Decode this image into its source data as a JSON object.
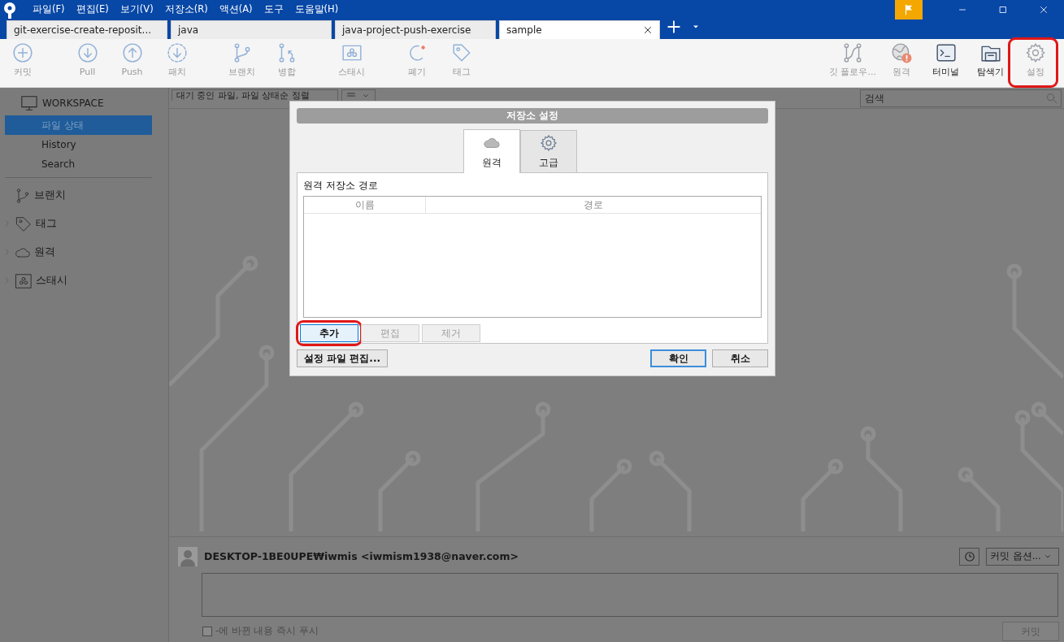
{
  "title_bar": {
    "menus": [
      "파일(F)",
      "편집(E)",
      "보기(V)",
      "저장소(R)",
      "액션(A)",
      "도구",
      "도움말(H)"
    ]
  },
  "tabs": [
    {
      "label": "git-exercise-create-reposit...",
      "selected": false
    },
    {
      "label": "java",
      "selected": false
    },
    {
      "label": "java-project-push-exercise",
      "selected": false
    },
    {
      "label": "sample",
      "selected": true
    }
  ],
  "toolbar": {
    "left_groups": [
      [
        {
          "label": "커밋",
          "kind": "commit",
          "disabled": true,
          "annotated": false
        }
      ],
      [
        {
          "label": "Pull",
          "kind": "pull",
          "disabled": true,
          "annotated": false
        },
        {
          "label": "Push",
          "kind": "push",
          "disabled": true,
          "annotated": false
        },
        {
          "label": "패치",
          "kind": "fetch",
          "disabled": true,
          "annotated": false
        }
      ],
      [
        {
          "label": "브랜치",
          "kind": "branch",
          "disabled": true,
          "annotated": false
        },
        {
          "label": "병합",
          "kind": "merge",
          "disabled": true,
          "annotated": false
        }
      ],
      [
        {
          "label": "스태시",
          "kind": "stash",
          "disabled": true,
          "annotated": false
        }
      ],
      [
        {
          "label": "폐기",
          "kind": "discard",
          "disabled": true,
          "annotated": false
        },
        {
          "label": "태그",
          "kind": "tag",
          "disabled": true,
          "annotated": false
        }
      ]
    ],
    "right": [
      {
        "label": "깃 플로우...",
        "kind": "gitflow",
        "disabled": true,
        "annotated": false
      },
      {
        "label": "원격",
        "kind": "remote",
        "disabled": true,
        "annotated": false
      },
      {
        "label": "터미널",
        "kind": "terminal",
        "disabled": false,
        "annotated": false
      },
      {
        "label": "탐색기",
        "kind": "explorer",
        "disabled": false,
        "annotated": false
      },
      {
        "label": "설정",
        "kind": "settings",
        "disabled": true,
        "annotated": true
      }
    ]
  },
  "sidebar": {
    "workspace": {
      "title": "WORKSPACE",
      "items": [
        {
          "label": "파일 상태",
          "selected": true
        },
        {
          "label": "History",
          "selected": false
        },
        {
          "label": "Search",
          "selected": false
        }
      ]
    },
    "sections": [
      {
        "label": "브랜치",
        "kind": "branch"
      },
      {
        "label": "태그",
        "kind": "tag",
        "expanded": false
      },
      {
        "label": "원격",
        "kind": "remote",
        "expanded": false
      },
      {
        "label": "스태시",
        "kind": "stash",
        "expanded": false
      }
    ]
  },
  "filter_bar": {
    "sort_dropdown": "대기 중인 파일, 파일 상태순 정렬",
    "search": {
      "placeholder": "검색"
    }
  },
  "commit_panel": {
    "author": "DESKTOP-1BE0UPE₩iwmis <iwmism1938@naver.com>",
    "options": "커밋 옵션...",
    "push_option": {
      "label": "-에 바뀐 내용 즉시 푸시",
      "checked": false
    },
    "commit_button": {
      "label": "커밋",
      "disabled": true
    }
  },
  "dialog": {
    "title": "저장소 설정",
    "tabs": [
      {
        "label": "원격",
        "kind": "remote",
        "selected": true
      },
      {
        "label": "고급",
        "kind": "advanced",
        "selected": false
      }
    ],
    "section_label": "원격 저장소 경로",
    "table": {
      "columns": [
        "이름",
        "경로"
      ]
    },
    "list_buttons": [
      {
        "label": "추가",
        "disabled": false,
        "annotated": true
      },
      {
        "label": "편집",
        "disabled": true,
        "annotated": false
      },
      {
        "label": "제거",
        "disabled": true,
        "annotated": false
      }
    ],
    "edit_config": "설정 파일 편집...",
    "buttons": [
      {
        "label": "확인",
        "default": true
      },
      {
        "label": "취소",
        "default": false
      }
    ]
  }
}
